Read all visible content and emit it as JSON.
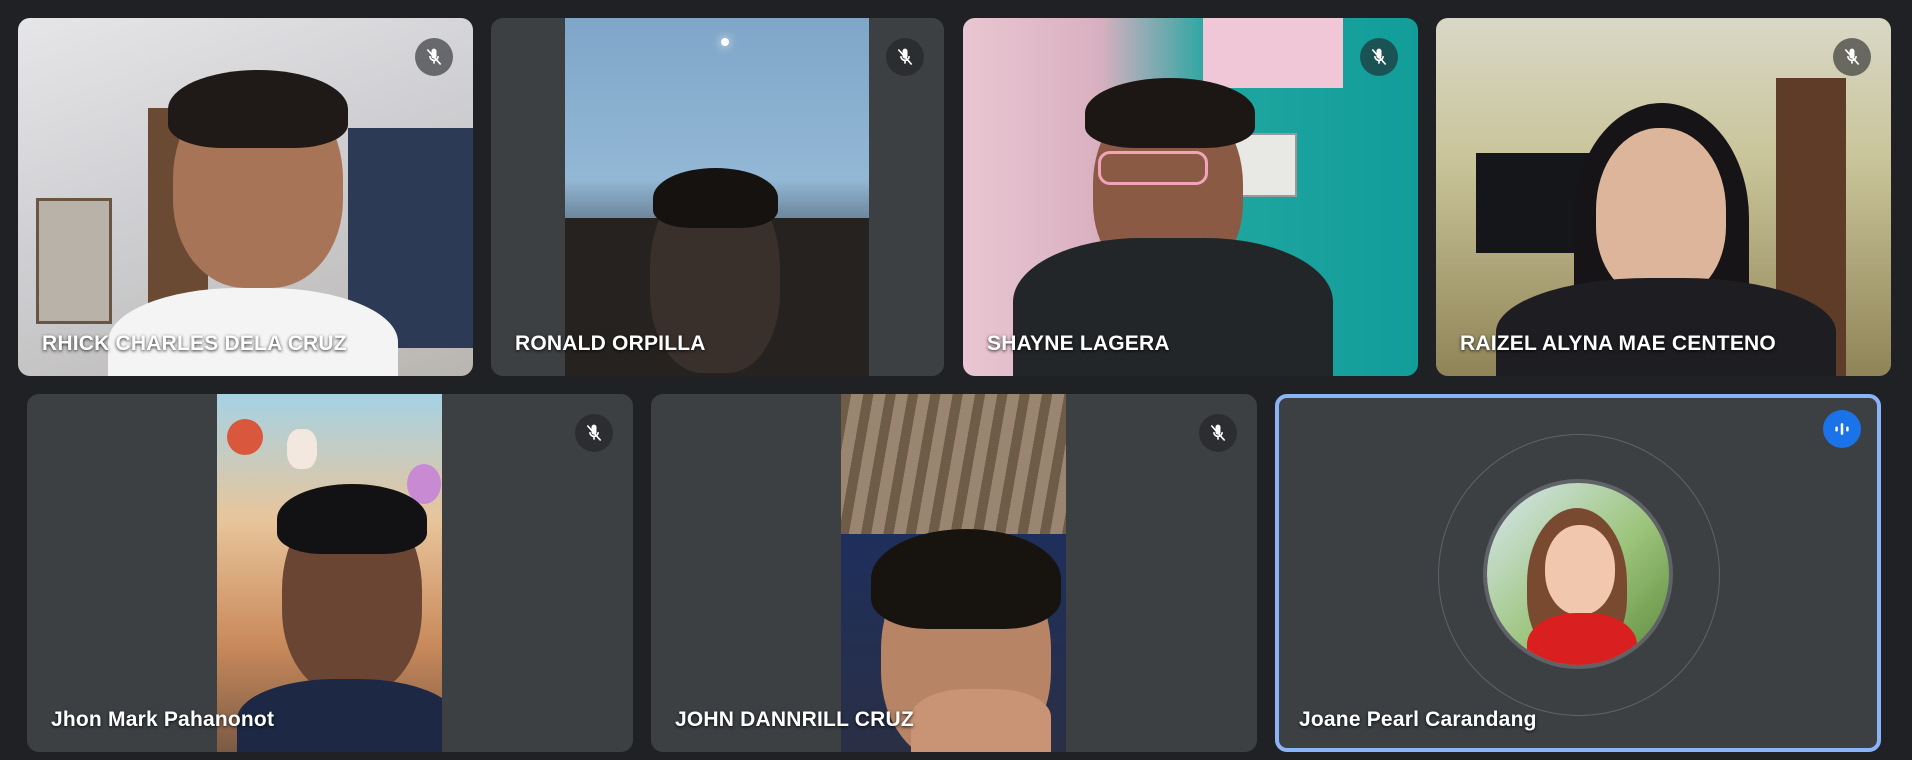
{
  "participants": [
    {
      "name": "RHICK CHARLES DELA CRUZ",
      "muted": true
    },
    {
      "name": "RONALD ORPILLA",
      "muted": true
    },
    {
      "name": "SHAYNE LAGERA",
      "muted": true
    },
    {
      "name": "RAIZEL ALYNA MAE CENTENO",
      "muted": true
    },
    {
      "name": "Jhon Mark Pahanonot",
      "muted": true
    },
    {
      "name": "JOHN DANNRILL CRUZ",
      "muted": true
    },
    {
      "name": "Joane Pearl Carandang",
      "muted": false,
      "speaking": true
    }
  ],
  "icons": {
    "muted": "mic-off-icon",
    "speaking": "audio-level-icon"
  },
  "colors": {
    "background": "#202124",
    "tile": "#3c4043",
    "active_border": "#8ab4f8",
    "speaking_badge": "#1a73e8"
  }
}
